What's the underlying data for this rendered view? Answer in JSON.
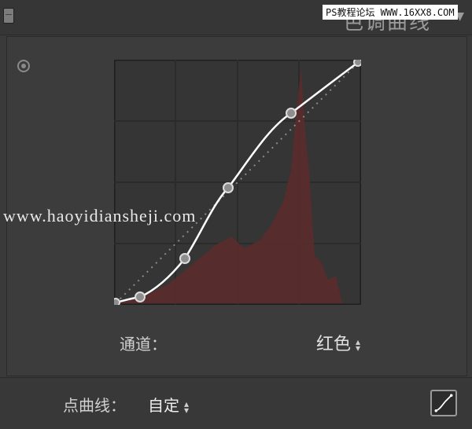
{
  "header": {
    "title": "色调曲线",
    "watermark": "PS教程论坛 WWW.16XX8.COM"
  },
  "graph": {
    "watermark": "www.haoyidiansheji.com"
  },
  "channel": {
    "label": "通道：",
    "value": "红色"
  },
  "point_curve": {
    "label": "点曲线：",
    "value": "自定"
  },
  "colors": {
    "histogram": "#5a2b2b",
    "curve": "#ffffff",
    "background": "#3a3a3a"
  }
}
